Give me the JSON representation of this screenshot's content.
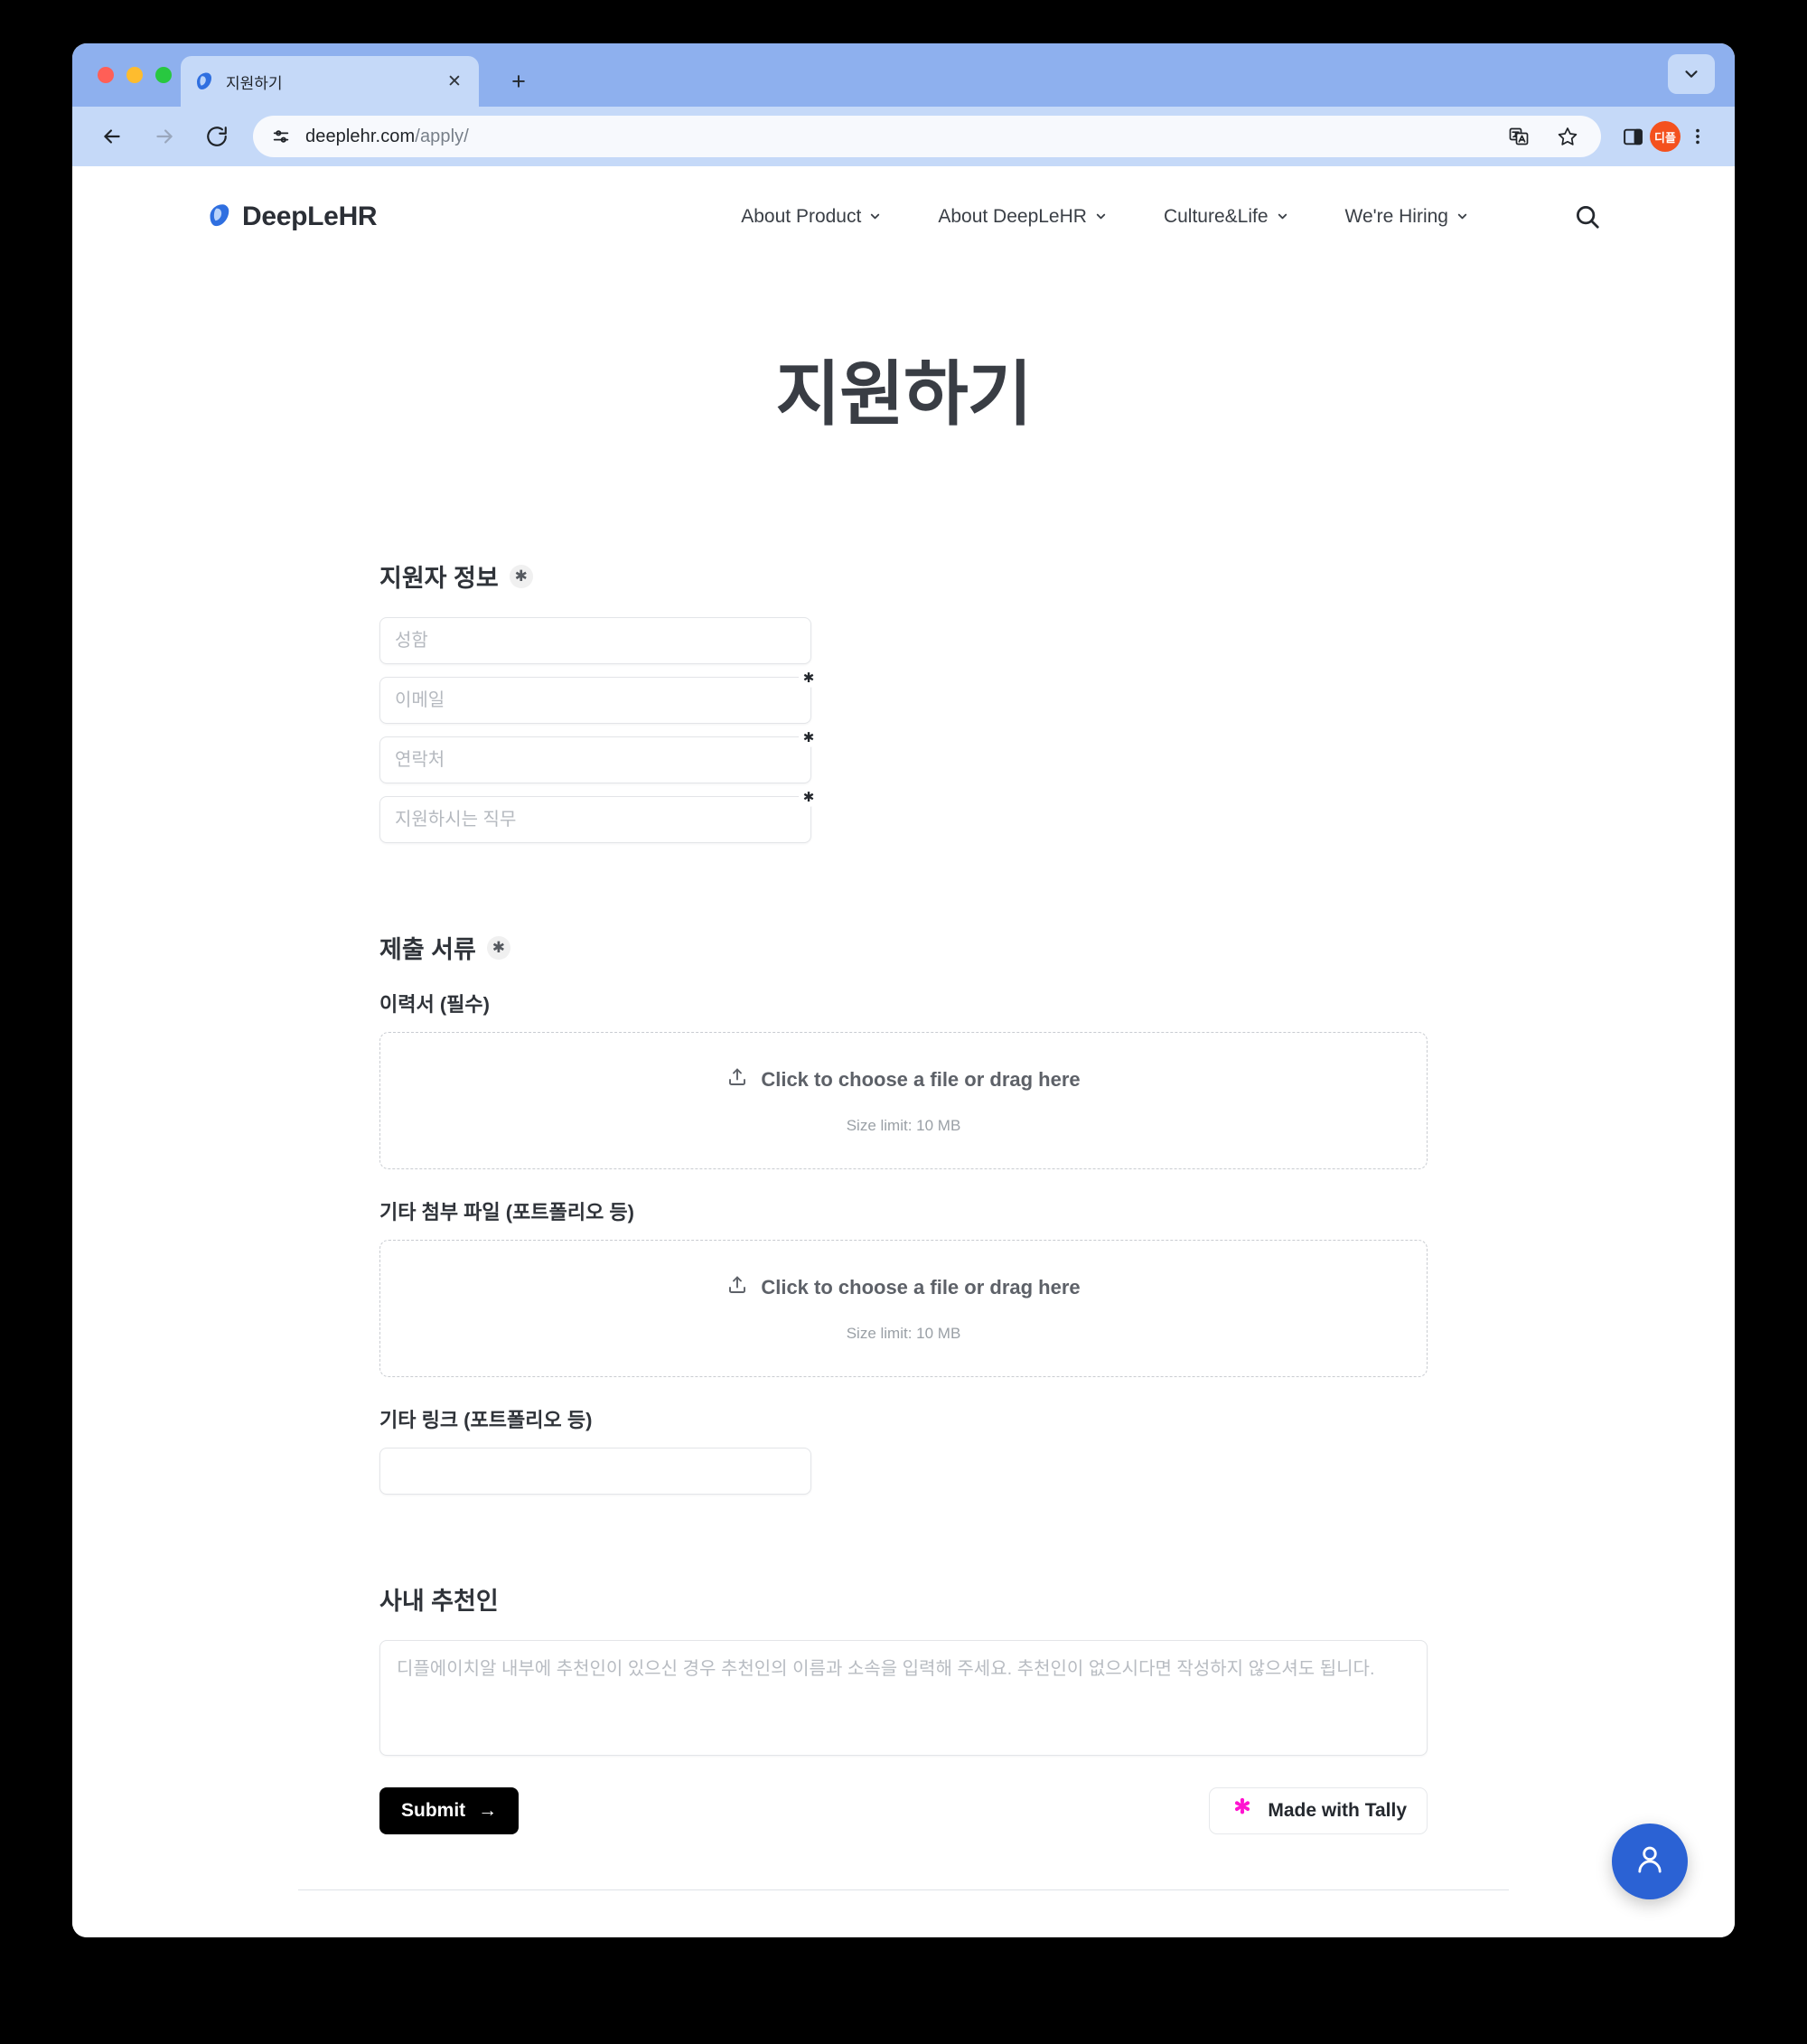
{
  "browser": {
    "tab": {
      "title": "지원하기",
      "favicon": "deeplehr-droplet-icon",
      "close": "✕"
    },
    "new_tab_label": "+",
    "url_host": "deeplehr.com",
    "url_path": "/apply/",
    "profile_initials": "디플",
    "accent": "#8eb0ee"
  },
  "site": {
    "brand": "DeepLeHR",
    "nav": [
      {
        "label": "About Product"
      },
      {
        "label": "About DeepLeHR"
      },
      {
        "label": "Culture&Life"
      },
      {
        "label": "We're Hiring"
      }
    ]
  },
  "page": {
    "title": "지원하기"
  },
  "form": {
    "applicant_section": {
      "title": "지원자 정보",
      "required_mark": "✱",
      "fields": [
        {
          "placeholder": "성함",
          "required_star": "",
          "has_star": false
        },
        {
          "placeholder": "이메일",
          "required_star": "✱",
          "has_star": true
        },
        {
          "placeholder": "연락처",
          "required_star": "✱",
          "has_star": true
        },
        {
          "placeholder": "지원하시는 직무",
          "required_star": "✱",
          "has_star": true
        }
      ]
    },
    "documents_section": {
      "title": "제출 서류",
      "required_mark": "✱",
      "resume_label": "이력서 (필수)",
      "attachments_label": "기타 첨부 파일 (포트폴리오 등)",
      "links_label": "기타 링크 (포트폴리오 등)",
      "dropzone_text": "Click to choose a file or drag here",
      "dropzone_limit": "Size limit: 10 MB",
      "link_value": ""
    },
    "referral_section": {
      "title": "사내 추천인",
      "placeholder": "디플에이치알 내부에 추천인이 있으신 경우 추천인의 이름과 소속을 입력해 주세요. 추천인이 없으시다면 작성하지 않으셔도 됩니다.",
      "value": ""
    },
    "submit_label": "Submit",
    "submit_arrow": "→",
    "tally_label": "Made with Tally",
    "tally_star_color": "#ff14d0"
  },
  "fab": {
    "icon": "person-icon",
    "color": "#2b62d4"
  }
}
